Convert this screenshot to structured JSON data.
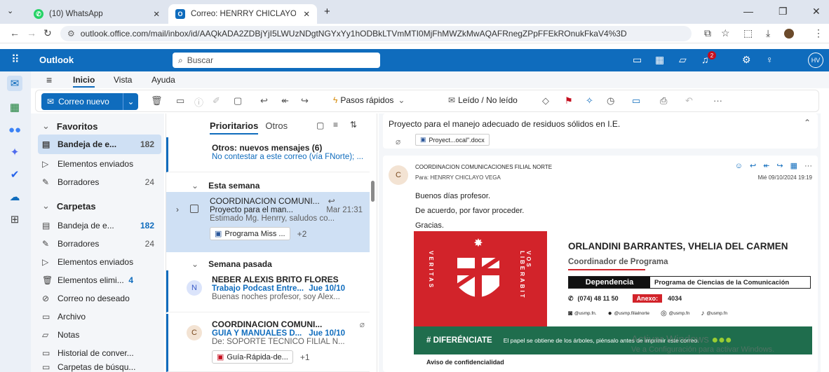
{
  "browser": {
    "tabs": [
      {
        "title": "(10) WhatsApp",
        "icon": "whatsapp-icon"
      },
      {
        "title": "Correo: HENRRY CHICLAYO VEC",
        "icon": "outlook-icon"
      }
    ],
    "url": "outlook.office.com/mail/inbox/id/AAQkADA2ZDBjYjI5LWUzNDgtNGYxYy1hODBkLTVmMTI0MjFhMWZkMwAQAFRnegZPpFFEkROnukFkaV4%3D"
  },
  "header": {
    "app_name": "Outlook",
    "search_placeholder": "Buscar",
    "avatar_initials": "HV",
    "notification_count": "2"
  },
  "menu": {
    "tabs": [
      "Inicio",
      "Vista",
      "Ayuda"
    ]
  },
  "ribbon": {
    "new_mail": "Correo nuevo",
    "quick_steps": "Pasos rápidos",
    "read_unread": "Leído / No leído",
    "more": "···"
  },
  "folders": {
    "favorites_label": "Favoritos",
    "favorites": [
      {
        "name": "Bandeja de e...",
        "count": "182",
        "icon": "inbox-icon"
      },
      {
        "name": "Elementos enviados",
        "count": "",
        "icon": "send-icon"
      },
      {
        "name": "Borradores",
        "count": "24",
        "icon": "pencil-icon"
      }
    ],
    "folders_label": "Carpetas",
    "items": [
      {
        "name": "Bandeja de e...",
        "count": "182",
        "icon": "inbox-icon"
      },
      {
        "name": "Borradores",
        "count": "24",
        "icon": "pencil-icon"
      },
      {
        "name": "Elementos enviados",
        "count": "",
        "icon": "send-icon"
      },
      {
        "name": "Elementos elimi...",
        "count": "4",
        "icon": "trash-icon"
      },
      {
        "name": "Correo no deseado",
        "count": "",
        "icon": "junk-icon"
      },
      {
        "name": "Archivo",
        "count": "",
        "icon": "archive-icon"
      },
      {
        "name": "Notas",
        "count": "",
        "icon": "note-icon"
      },
      {
        "name": "Historial de conver...",
        "count": "",
        "icon": "folder-icon"
      },
      {
        "name": "Carpetas de búsqu...",
        "count": "",
        "icon": "search-folder-icon"
      }
    ]
  },
  "list": {
    "tab_focused": "Prioritarios",
    "tab_other": "Otros",
    "other_title": "Otros: nuevos mensajes (6)",
    "other_sub": "No contestar a este correo (vía FNorte); ...",
    "group1": "Esta semana",
    "group2": "Semana pasada",
    "messages": [
      {
        "sender": "COORDINACION COMUNI...",
        "subject": "Proyecto para el man...",
        "date": "Mar 21:31",
        "preview": "Estimado Mg. Henrry, saludos co...",
        "attachment": "Programa Miss ...",
        "extra": "+2",
        "initial": ""
      },
      {
        "sender": "NEBER ALEXIS BRITO FLORES",
        "subject": "Trabajo Podcast Entre...",
        "date": "Jue 10/10",
        "preview": "Buenas noches profesor, soy Alex...",
        "attachment": "",
        "extra": "",
        "initial": "N"
      },
      {
        "sender": "COORDINACION COMUNI...",
        "subject": "GUIA Y MANUALES D...",
        "date": "Jue 10/10",
        "preview": "De: SOPORTE TECNICO FILIAL N...",
        "attachment": "Guía-Rápida-de...",
        "extra": "+1",
        "initial": "C"
      }
    ]
  },
  "reading": {
    "subject": "Proyecto para el manejo adecuado de residuos sólidos en I.E.",
    "attachment": "Proyect...ocal\".docx",
    "from": "COORDINACION COMUNICACIONES FILIAL NORTE",
    "to": "Para:  HENRRY CHICLAYO VEGA",
    "date": "Mié 09/10/2024 19:19",
    "initial": "C",
    "body": [
      "Buenos días profesor.",
      "De acuerdo, por favor proceder.",
      "Gracias."
    ]
  },
  "signature": {
    "name": "ORLANDINI BARRANTES, VHELIA DEL CARMEN",
    "role": "Coordinador de Programa",
    "dep_label": "Dependencia",
    "dep_value": "Programa de Ciencias de la Comunicación",
    "phone": "(074) 48 11 50",
    "annex_label": "Anexo:",
    "annex": "4034",
    "social": [
      "@usmp.fn.",
      "@usmp.filialnorte",
      "@usmp.fn",
      "@usmp.fn"
    ],
    "motto_left": "VERITAS",
    "motto_right": "VOS LIBERABIT",
    "tag": "# DIFERÉNCIATE",
    "tagline": "El papel se obtiene de los árboles, piénsalo antes de imprimir este correo.",
    "notice": "Aviso de confidencialidad"
  },
  "watermark": {
    "line1": "Activar Windows",
    "line2": "Ve a Configuración para activar Windows."
  },
  "colors": {
    "outlook_blue": "#0f6cbd",
    "usmp_red": "#d2232a",
    "band_green": "#1f6d4d"
  }
}
